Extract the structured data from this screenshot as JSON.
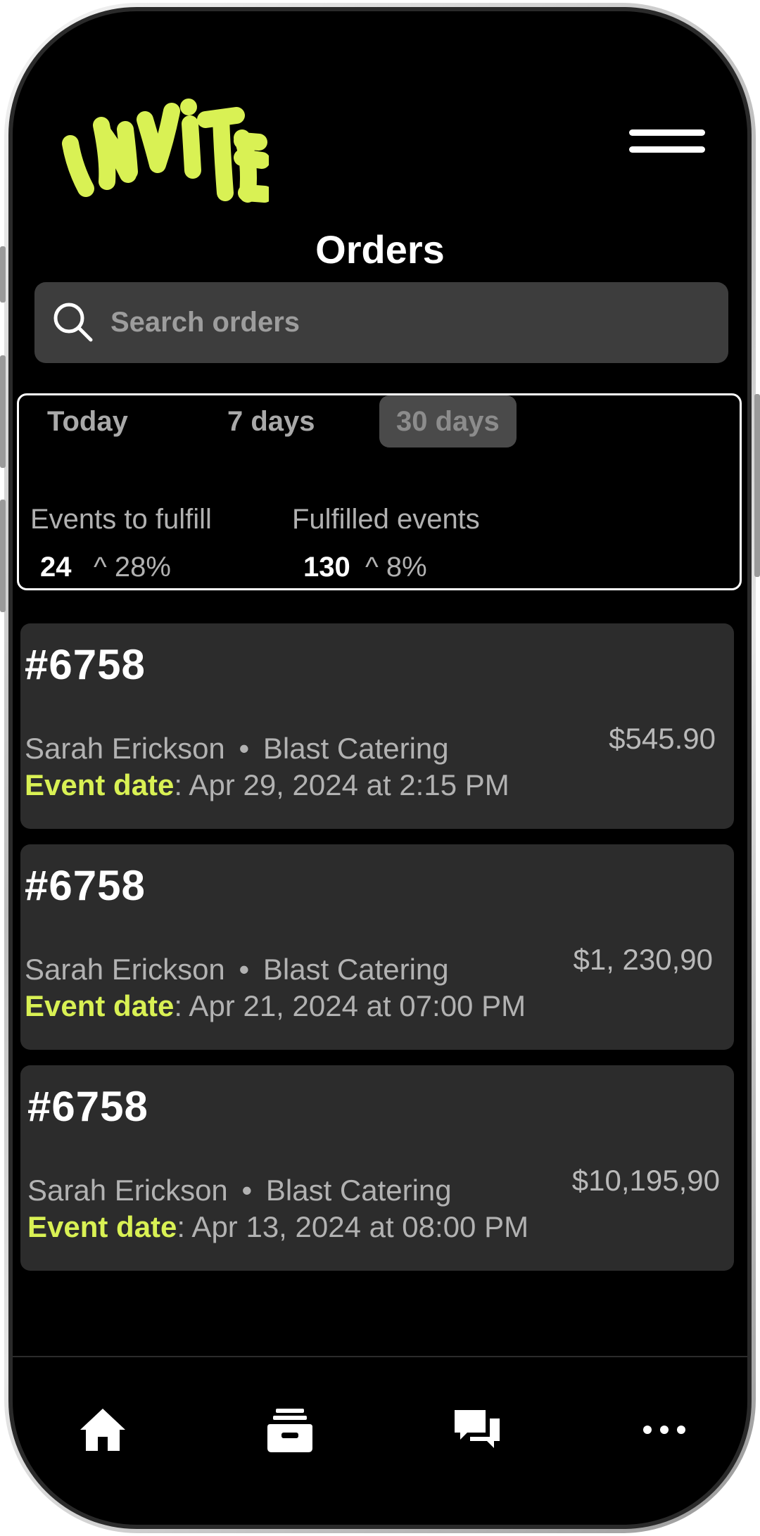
{
  "app": {
    "logo_text": "invite",
    "brand_color": "#d9f154"
  },
  "header": {
    "title": "Orders",
    "menu_icon": "hamburger-menu-icon"
  },
  "search": {
    "placeholder": "Search orders",
    "value": ""
  },
  "filters": {
    "tabs": [
      {
        "label": "Today",
        "active": false
      },
      {
        "label": "7 days",
        "active": false
      },
      {
        "label": "30 days",
        "active": true
      }
    ]
  },
  "stats": [
    {
      "label": "Events to fulfill",
      "value": "24",
      "change": "^ 28%"
    },
    {
      "label": "Fulfilled events",
      "value": "130",
      "change": "^ 8%"
    }
  ],
  "orders": [
    {
      "id": "#6758",
      "customer": "Sarah Erickson",
      "separator": "•",
      "vendor": "Blast Catering",
      "date_label": "Event date",
      "date_value": ": Apr 29, 2024 at 2:15 PM",
      "amount": "$545.90"
    },
    {
      "id": "#6758",
      "customer": "Sarah Erickson",
      "separator": "•",
      "vendor": "Blast Catering",
      "date_label": "Event date",
      "date_value": ": Apr 21, 2024 at 07:00 PM",
      "amount": "$1, 230,90"
    },
    {
      "id": "#6758",
      "customer": "Sarah Erickson",
      "separator": "•",
      "vendor": "Blast Catering",
      "date_label": "Event date",
      "date_value": ": Apr 13, 2024 at 08:00 PM",
      "amount": "$10,195,90"
    }
  ],
  "bottom_nav": [
    {
      "icon": "home-icon"
    },
    {
      "icon": "inbox-tray-icon"
    },
    {
      "icon": "chat-bubbles-icon"
    },
    {
      "icon": "more-dots-icon"
    }
  ]
}
